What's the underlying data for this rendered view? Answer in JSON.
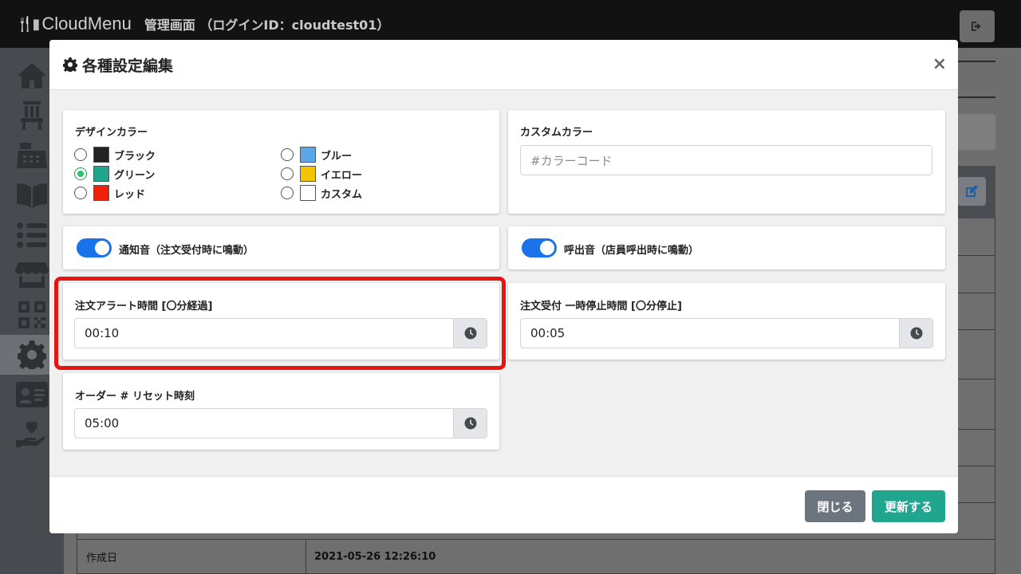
{
  "app": {
    "logo_glyph": "🍴▮",
    "logo_text": "CloudMenu",
    "admin_title": "管理画面 （ログインID：cloudtest01）"
  },
  "sidebar": {
    "items": [
      {
        "icon": "home-icon"
      },
      {
        "icon": "chair-icon"
      },
      {
        "icon": "cash-register-icon"
      },
      {
        "icon": "book-icon"
      },
      {
        "icon": "list-icon"
      },
      {
        "icon": "store-icon"
      },
      {
        "icon": "qrcode-icon"
      },
      {
        "icon": "gear-icon",
        "active": true
      },
      {
        "icon": "id-card-icon"
      },
      {
        "icon": "hand-heart-icon"
      }
    ]
  },
  "background": {
    "created_label": "作成日",
    "created_value": "2021-05-26 12:26:10"
  },
  "modal": {
    "title": "各種設定編集",
    "close_symbol": "×",
    "design_color": {
      "label": "デザインカラー",
      "options": [
        {
          "label": "ブラック",
          "color": "#222222",
          "checked": false
        },
        {
          "label": "グリーン",
          "color": "#20a58f",
          "checked": true
        },
        {
          "label": "レッド",
          "color": "#f21f0a",
          "checked": false
        },
        {
          "label": "ブルー",
          "color": "#5aa6e6",
          "checked": false
        },
        {
          "label": "イエロー",
          "color": "#f5c400",
          "checked": false
        },
        {
          "label": "カスタム",
          "color": "#ffffff",
          "checked": false
        }
      ]
    },
    "custom_color": {
      "label": "カスタムカラー",
      "placeholder": "#カラーコード",
      "value": ""
    },
    "notify_sound": {
      "label": "通知音（注文受付時に鳴動）",
      "on": true
    },
    "call_sound": {
      "label": "呼出音（店員呼出時に鳴動）",
      "on": true
    },
    "order_alert": {
      "label": "注文アラート時間 [〇分経過]",
      "value": "00:10"
    },
    "pause_time": {
      "label": "注文受付 一時停止時間 [〇分停止]",
      "value": "00:05"
    },
    "order_reset": {
      "label": "オーダー # リセット時刻",
      "value": "05:00"
    },
    "buttons": {
      "close": "閉じる",
      "update": "更新する"
    }
  },
  "colors": {
    "accent_green": "#20a58f",
    "toggle_blue": "#1a73e8",
    "highlight_red": "#e8140f"
  }
}
